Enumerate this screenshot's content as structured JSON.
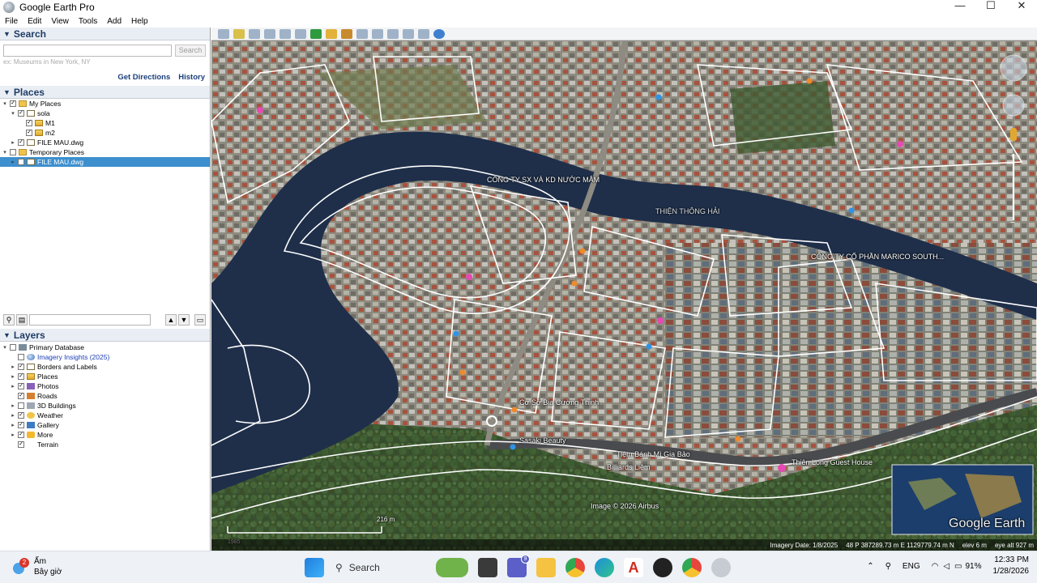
{
  "window": {
    "title": "Google Earth Pro",
    "controls": [
      "—",
      "☐",
      "✕"
    ]
  },
  "menu": [
    "File",
    "Edit",
    "View",
    "Tools",
    "Add",
    "Help"
  ],
  "search": {
    "header": "Search",
    "placeholder": "",
    "button": "Search",
    "hint": "ex: Museums in New York, NY",
    "get_directions": "Get Directions",
    "history": "History"
  },
  "places": {
    "header": "Places",
    "items": [
      {
        "label": "My Places",
        "indent": 0,
        "icon": "folder-icon",
        "expand": "▾",
        "checked": true
      },
      {
        "label": "sola",
        "indent": 1,
        "icon": "polygon-icon",
        "expand": "▾",
        "checked": true
      },
      {
        "label": "M1",
        "indent": 2,
        "icon": "placemark-icon",
        "expand": "",
        "checked": true
      },
      {
        "label": "m2",
        "indent": 2,
        "icon": "placemark-icon",
        "expand": "",
        "checked": true
      },
      {
        "label": "FILE MAU.dwg",
        "indent": 1,
        "icon": "polygon-icon",
        "expand": "▸",
        "checked": true
      },
      {
        "label": "Temporary Places",
        "indent": 0,
        "icon": "folder-icon",
        "expand": "▾",
        "checked": false
      },
      {
        "label": "FILE MAU.dwg",
        "indent": 1,
        "icon": "polygon-icon",
        "expand": "▸",
        "checked": true,
        "selected": true
      }
    ]
  },
  "layers": {
    "header": "Layers",
    "items": [
      {
        "label": "Primary Database",
        "indent": 0,
        "icon": "database-icon",
        "expand": "▾",
        "checked": false
      },
      {
        "label": "Imagery Insights (2025)",
        "indent": 1,
        "icon": "globe-icon",
        "expand": "",
        "checked": false,
        "link": true
      },
      {
        "label": "Borders and Labels",
        "indent": 1,
        "icon": "borders-icon",
        "expand": "▸",
        "checked": true
      },
      {
        "label": "Places",
        "indent": 1,
        "icon": "places-icon",
        "expand": "▸",
        "checked": true
      },
      {
        "label": "Photos",
        "indent": 1,
        "icon": "photos-icon",
        "expand": "▸",
        "checked": true
      },
      {
        "label": "Roads",
        "indent": 1,
        "icon": "roads-icon",
        "expand": "",
        "checked": true
      },
      {
        "label": "3D Buildings",
        "indent": 1,
        "icon": "buildings-icon",
        "expand": "▸",
        "checked": false
      },
      {
        "label": "Weather",
        "indent": 1,
        "icon": "weather-icon",
        "expand": "▸",
        "checked": true
      },
      {
        "label": "Gallery",
        "indent": 1,
        "icon": "gallery-icon",
        "expand": "▸",
        "checked": true
      },
      {
        "label": "More",
        "indent": 1,
        "icon": "more-icon",
        "expand": "▸",
        "checked": true
      },
      {
        "label": "Terrain",
        "indent": 1,
        "icon": "terrain-icon",
        "expand": "",
        "checked": true
      }
    ]
  },
  "map": {
    "labels": [
      "CÔNG TY SX VÀ KD NƯỚC MẮM",
      "THIỆN THÔNG HẢI",
      "CÔNG TY CỔ PHẦN MARICO SOUTH...",
      "Cơ Sở Bia Cường Thịnh",
      "Sasaki Beauty",
      "Tiệm Bánh Mì Gia Bảo",
      "Thiên Long Guest House",
      "Billiards Liêm",
      "Image © 2026 Airbus"
    ],
    "scale": "216 m",
    "watermark": "Google Earth",
    "year": "1985",
    "status": {
      "imagery_date": "Imagery Date: 1/8/2025",
      "coords": "48 P 387289.73 m E 1129779.74 m N",
      "elev": "elev   6 m",
      "eye_alt": "eye alt   927 m"
    }
  },
  "taskbar": {
    "weather_temp": "Ấm",
    "weather_sub": "Bây giờ",
    "weather_badge": "2",
    "search": "Search",
    "lang": "ENG",
    "battery": "91%",
    "time": "12:33 PM",
    "date": "1/28/2026",
    "teams_badge": "9"
  }
}
